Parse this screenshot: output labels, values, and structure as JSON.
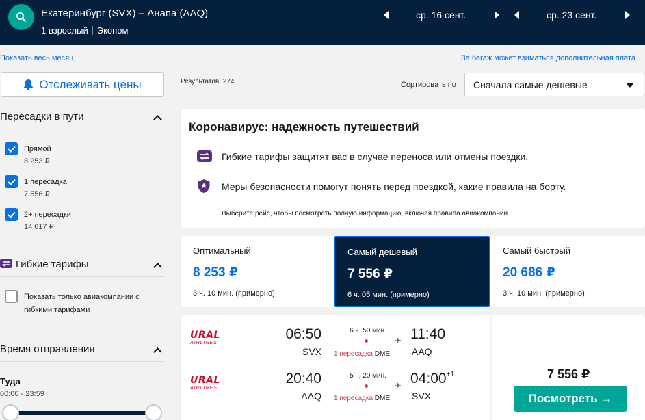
{
  "header": {
    "route": "Екатеринбург (SVX) – Анапа (AAQ)",
    "passengers": "1 взрослый",
    "cabin": "Эконом",
    "depart_date": "ср. 16 сент.",
    "return_date": "ср. 23 сент."
  },
  "links": {
    "show_month": "Показать весь месяц",
    "baggage": "За багаж может взиматься дополнительная плата"
  },
  "sidebar": {
    "track_button": "Отслеживать цены",
    "stops_title": "Пересадки в пути",
    "stops": [
      {
        "label": "Прямой",
        "price": "8 253 ₽",
        "checked": true
      },
      {
        "label": "1 пересадка",
        "price": "7 556 ₽",
        "checked": true
      },
      {
        "label": "2+ пересадки",
        "price": "14 617 ₽",
        "checked": true
      }
    ],
    "flex_title": "Гибкие тарифы",
    "flex_option_line1": "Показать только авиакомпании с",
    "flex_option_line2": "гибкими тарифами",
    "flex_checked": false,
    "time_title": "Время отправления",
    "outbound_label": "Туда",
    "outbound_range": "00:00 - 23:59"
  },
  "main": {
    "results": "Результатов: 274",
    "sort_label": "Сортировать по",
    "sort_value": "Сначала самые дешевые"
  },
  "covid": {
    "title": "Коронавирус: надежность путешествий",
    "line1": "Гибкие тарифы защитят вас в случае переноса или отмены поездки.",
    "line2": "Меры безопасности помогут понять перед поездкой, какие правила на борту.",
    "note": "Выберите рейс, чтобы посмотреть полную информацию, включая правила авиакомпании."
  },
  "tabs": [
    {
      "name": "Оптимальный",
      "price": "8 253 ₽",
      "duration": "3 ч. 10 мин. (примерно)",
      "active": false
    },
    {
      "name": "Самый дешевый",
      "price": "7 556 ₽",
      "duration": "6 ч. 05 мин. (примерно)",
      "active": true
    },
    {
      "name": "Самый быстрый",
      "price": "20 686 ₽",
      "duration": "3 ч. 10 мин. (примерно)",
      "active": false
    }
  ],
  "flight": {
    "airline_top": "URAL",
    "airline_bottom": "AIRLINES",
    "legs": [
      {
        "dep_time": "06:50",
        "dep_code": "SVX",
        "duration": "6 ч. 50 мин.",
        "stops": "1 пересадка",
        "via": "DME",
        "arr_time": "11:40",
        "arr_code": "AAQ",
        "day_offset": ""
      },
      {
        "dep_time": "20:40",
        "dep_code": "AAQ",
        "duration": "5 ч. 20 мин.",
        "stops": "1 пересадка",
        "via": "DME",
        "arr_time": "04:00",
        "arr_code": "SVX",
        "day_offset": "+1"
      }
    ],
    "price": "7 556 ₽",
    "view_button": "Посмотреть →"
  },
  "colors": {
    "header_bg": "#05203c",
    "link": "#0770e3",
    "accent": "#00a698",
    "stop_red": "#d1435b"
  }
}
